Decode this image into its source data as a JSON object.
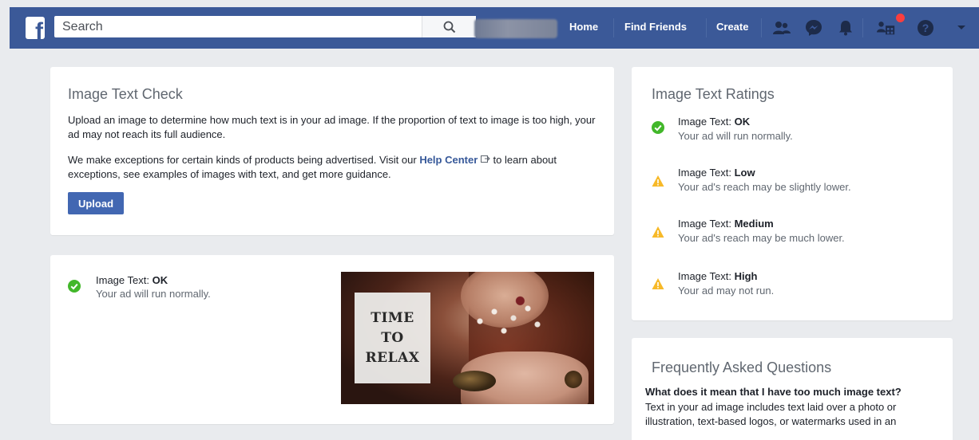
{
  "header": {
    "logo_letter": "f",
    "search_placeholder": "Search",
    "nav": {
      "home": "Home",
      "find_friends": "Find Friends",
      "create": "Create"
    },
    "colors": {
      "bar": "#3b5998",
      "badge": "#fa3e3e"
    }
  },
  "check_card": {
    "title": "Image Text Check",
    "para1": "Upload an image to determine how much text is in your ad image. If the proportion of text to image is too high, your ad may not reach its full audience.",
    "para2_before": "We make exceptions for certain kinds of products being advertised. Visit our ",
    "help_link": "Help Center",
    "para2_after": " to learn about exceptions, see examples of images with text, and get more guidance.",
    "upload_label": "Upload"
  },
  "result_card": {
    "status_prefix": "Image Text: ",
    "status_value": "OK",
    "status_sub": "Your ad will run normally.",
    "image_text": [
      "TIME",
      "TO",
      "RELAX"
    ]
  },
  "ratings": {
    "title": "Image Text Ratings",
    "items": [
      {
        "prefix": "Image Text: ",
        "level": "OK",
        "desc": "Your ad will run normally.",
        "icon": "check-circle-icon"
      },
      {
        "prefix": "Image Text: ",
        "level": "Low",
        "desc": "Your ad's reach may be slightly lower.",
        "icon": "warning-icon"
      },
      {
        "prefix": "Image Text: ",
        "level": "Medium",
        "desc": "Your ad's reach may be much lower.",
        "icon": "warning-icon"
      },
      {
        "prefix": "Image Text: ",
        "level": "High",
        "desc": "Your ad may not run.",
        "icon": "warning-icon"
      }
    ],
    "colors": {
      "ok": "#42b72a",
      "warn": "#f7b928"
    }
  },
  "faq": {
    "title": "Frequently Asked Questions",
    "question": "What does it mean that I have too much image text?",
    "answer": "Text in your ad image includes text laid over a photo or illustration, text-based logos, or watermarks used in an"
  }
}
